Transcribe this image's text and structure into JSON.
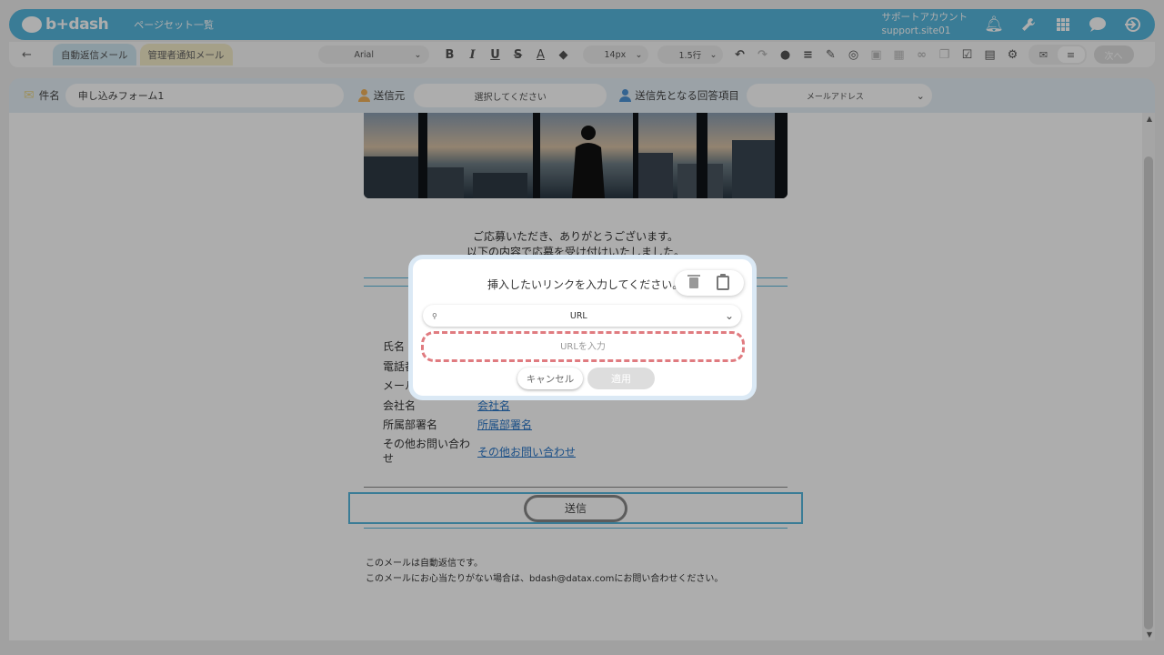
{
  "header": {
    "logo_text": "b+dash",
    "page_link": "ページセット一覧",
    "account_name": "サポートアカウント",
    "account_site": "support.site01",
    "accent_color": "#56b7dd"
  },
  "toolbar": {
    "tabs": [
      {
        "label": "自動返信メール",
        "active": true
      },
      {
        "label": "管理者通知メール",
        "active": false
      }
    ],
    "font_family": "Arial",
    "font_size": "14px",
    "line_height": "1.5行",
    "next_label": "次へ"
  },
  "subject_bar": {
    "subject_label": "件名",
    "subject_value": "申し込みフォーム1",
    "sender_label": "送信元",
    "sender_placeholder": "選択してください",
    "recipient_label": "送信先となる回答項目",
    "recipient_value": "メールアドレス"
  },
  "email": {
    "thanks_line1": "ご応募いただき、ありがとうございます。",
    "thanks_line2": "以下の内容で応募を受け付けいたしました。",
    "fields": [
      {
        "label": "氏名",
        "value": ""
      },
      {
        "label": "電話番号",
        "value": ""
      },
      {
        "label": "メールアドレス",
        "value": ""
      },
      {
        "label": "会社名",
        "value": "会社名"
      },
      {
        "label": "所属部署名",
        "value": "所属部署名"
      },
      {
        "label": "その他お問い合わせ",
        "value": "その他お問い合わせ"
      }
    ],
    "submit_label": "送信",
    "footer_line1": "このメールは自動返信です。",
    "footer_line2": "このメールにお心当たりがない場合は、bdash@datax.comにお問い合わせください。"
  },
  "modal": {
    "title": "挿入したいリンクを入力してください。",
    "link_type": "URL",
    "url_placeholder": "URLを入力",
    "cancel_label": "キャンセル",
    "apply_label": "適用",
    "highlight_color": "#e07b80"
  }
}
